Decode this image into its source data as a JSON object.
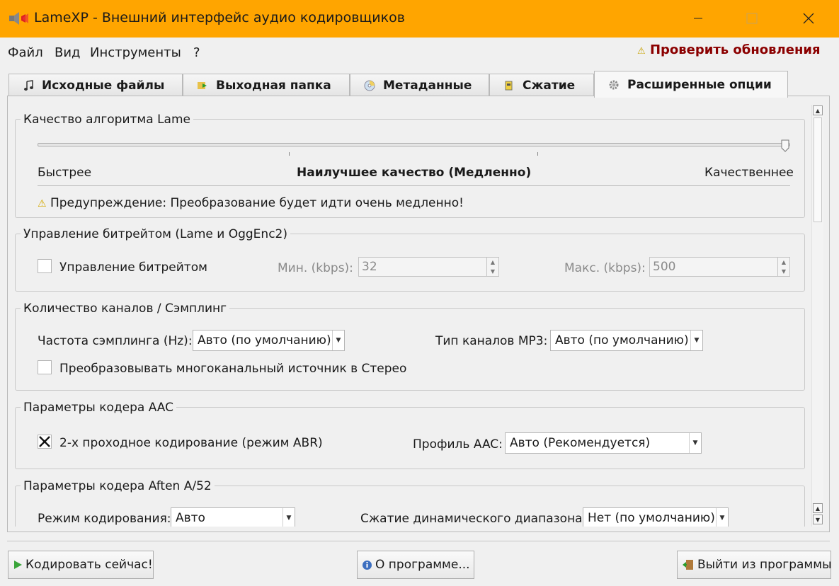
{
  "window": {
    "title": "LameXP - Внешний интерфейс аудио кодировщиков"
  },
  "menu": {
    "items": [
      "Файл",
      "Вид",
      "Инструменты",
      "?"
    ],
    "update": "Проверить обновления"
  },
  "tabs": [
    {
      "label": "Исходные файлы",
      "icon": "music-note-icon"
    },
    {
      "label": "Выходная папка",
      "icon": "folder-arrow-icon"
    },
    {
      "label": "Метаданные",
      "icon": "cd-icon"
    },
    {
      "label": "Сжатие",
      "icon": "compress-icon"
    },
    {
      "label": "Расширенные опции",
      "icon": "gear-icon",
      "active": true
    }
  ],
  "lame_quality": {
    "title": "Качество алгоритма Lame",
    "slider_value": 1.0,
    "left_label": "Быстрее",
    "center_label": "Наилучшее качество (Медленно)",
    "right_label": "Качественнее",
    "warning": "Предупреждение: Преобразование будет идти очень медленно!"
  },
  "bitrate": {
    "title": "Управление битрейтом  (Lame и OggEnc2)",
    "checkbox_label": "Управление битрейтом",
    "checked": false,
    "min_label": "Мин. (kbps):",
    "min_value": "32",
    "max_label": "Макс. (kbps):",
    "max_value": "500"
  },
  "channels": {
    "title": "Количество каналов / Сэмплинг",
    "rate_label": "Частота сэмплинга (Hz):",
    "rate_value": "Авто (по умолчанию)",
    "mp3_label": "Тип каналов MP3:",
    "mp3_value": "Авто (по умолчанию)",
    "stereo_label": "Преобразовывать многоканальный источник в Стерео",
    "stereo_checked": false
  },
  "aac": {
    "title": "Параметры кодера AAC",
    "twopass_label": "2-х проходное кодирование (режим ABR)",
    "twopass_checked": true,
    "profile_label": "Профиль AAC:",
    "profile_value": "Авто (Рекомендуется)"
  },
  "aften": {
    "title": "Параметры кодера Aften A/52",
    "mode_label": "Режим кодирования:",
    "mode_value": "Авто",
    "drc_label": "Сжатие динамического диапазона:",
    "drc_value": "Нет (по умолчанию)"
  },
  "buttons": {
    "encode": "Кодировать сейчас!",
    "about": "О программе...",
    "exit": "Выйти из программы"
  },
  "colors": {
    "titlebar": "#ffa500",
    "update_link": "#8b0000"
  }
}
